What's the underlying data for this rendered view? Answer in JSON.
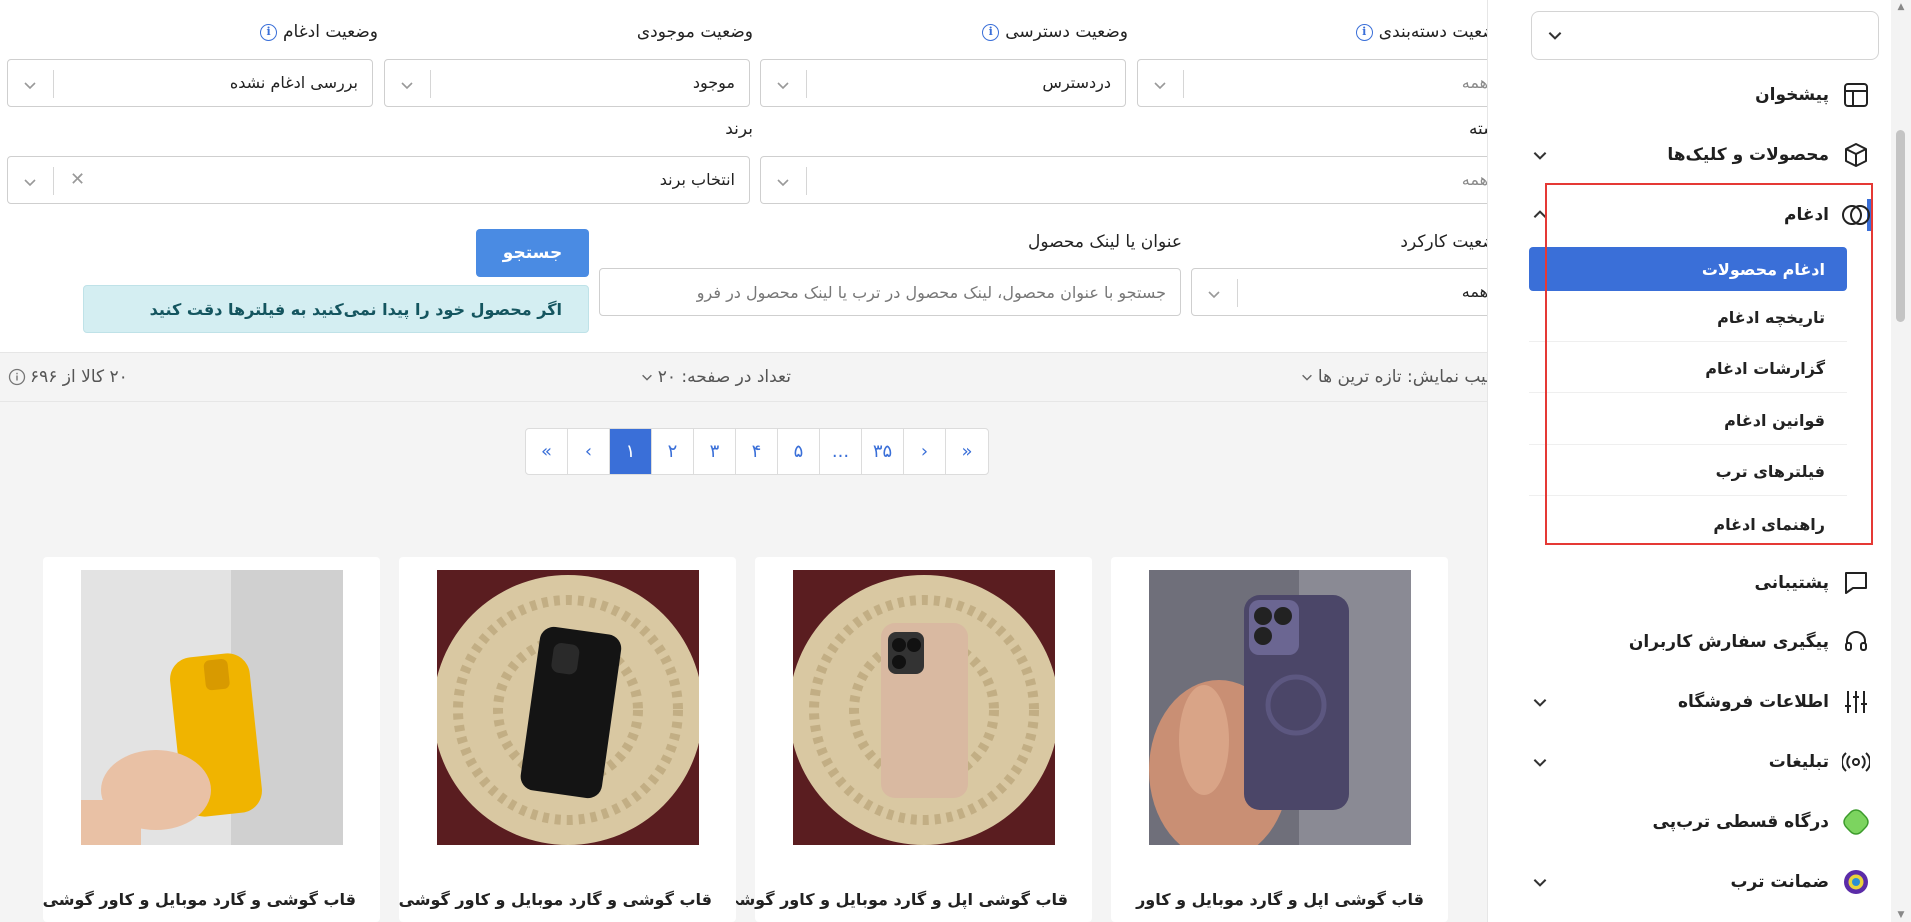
{
  "sidebar": {
    "top_select_value": "",
    "nav": {
      "dashboard": "پیشخوان",
      "products_clicks": "محصولات و کلیک‌ها",
      "merge": "ادغام",
      "support": "پشتیبانی",
      "order_tracking": "پیگیری سفارش کاربران",
      "store_info": "اطلاعات فروشگاه",
      "ads": "تبلیغات",
      "installment": "درگاه قسطی ترب‌پی",
      "guarantee": "ضمانت ترب"
    },
    "merge_sub": {
      "active": "ادغام محصولات",
      "items": [
        "تاریخچه ادغام",
        "گزارشات ادغام",
        "قوانین ادغام",
        "فیلترهای ترب",
        "راهنمای ادغام"
      ]
    }
  },
  "filters": {
    "category_status": {
      "label": "وضعیت دسته‌بندی",
      "value": "همه"
    },
    "access_status": {
      "label": "وضعیت دسترسی",
      "value": "دردسترس"
    },
    "stock_status": {
      "label": "وضعیت موجودی",
      "value": "موجود"
    },
    "merge_status": {
      "label": "وضعیت ادغام",
      "value": "بررسی ادغام نشده"
    },
    "category": {
      "label": "دسته",
      "value": "همه"
    },
    "brand": {
      "label": "برند",
      "value": "انتخاب برند"
    },
    "performance": {
      "label": "وضعیت کارکرد",
      "value": "همه"
    },
    "title_link": {
      "label": "عنوان یا لینک محصول",
      "placeholder": "جستجو با عنوان محصول، لینک محصول در ترب یا لینک محصول در فرو"
    },
    "search_button": "جستجو",
    "alert": "اگر محصول خود را پیدا نمی‌کنید به فیلترها دقت کنید"
  },
  "toolbar": {
    "sort": "ترتیب نمایش: تازه ترین ها",
    "per_page": "تعداد در صفحه: ۲۰",
    "count": "۲۰ کالا از ۶۹۶"
  },
  "pagination": [
    "«",
    "‹",
    "۱",
    "۲",
    "۳",
    "۴",
    "۵",
    "...",
    "۳۵",
    "›",
    "»"
  ],
  "products": [
    {
      "title": "قاب گوشی اپل و گارد موبایل و کاور"
    },
    {
      "title": "قاب گوشی اپل و گارد موبایل و کاور گوشی"
    },
    {
      "title": "قاب گوشی و گارد موبایل و کاور گوشی"
    },
    {
      "title": "قاب گوشی و گارد موبایل و کاور گوشی"
    }
  ],
  "colors": {
    "accent": "#3a6fd8",
    "button": "#4a8be3",
    "alert_bg": "#d4eef2",
    "highlight": "#e53935"
  }
}
